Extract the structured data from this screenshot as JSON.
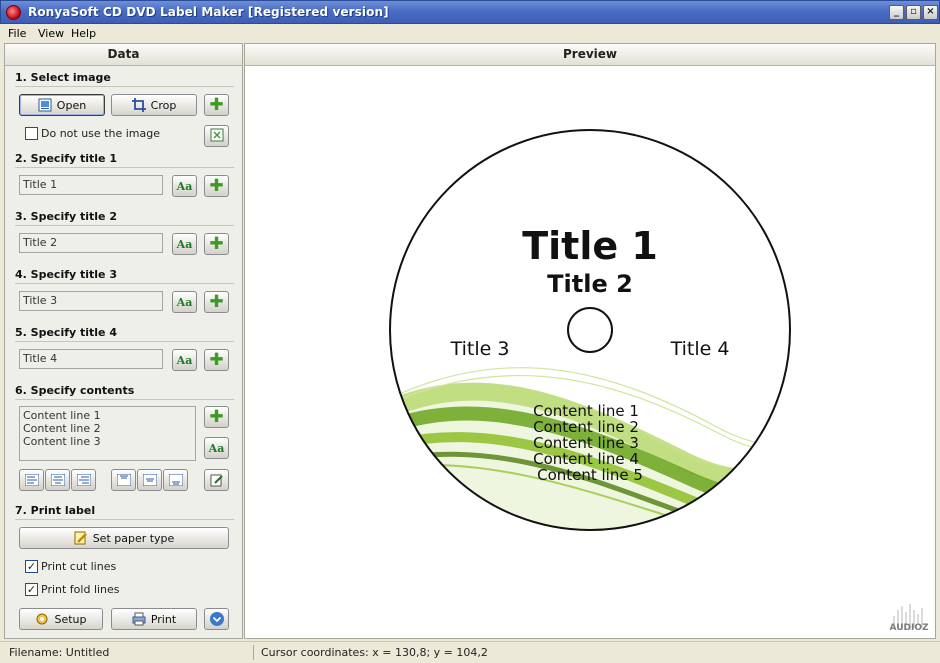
{
  "window": {
    "title": "RonyaSoft CD DVD Label Maker [Registered version]"
  },
  "menu": [
    "File",
    "View",
    "Help"
  ],
  "panels": {
    "data": "Data",
    "preview": "Preview"
  },
  "sections": {
    "select_image": "1. Select image",
    "title1": "2. Specify title 1",
    "title2": "3. Specify title 2",
    "title3": "4. Specify title 3",
    "title4": "5. Specify title 4",
    "contents": "6. Specify contents",
    "print": "7. Print label"
  },
  "buttons": {
    "open": "Open",
    "crop": "Crop",
    "set_paper": "Set paper type",
    "setup": "Setup",
    "print": "Print",
    "font_glyph": "Aa"
  },
  "checkboxes": {
    "no_image": {
      "label": "Do not use the image",
      "checked": false
    },
    "cut_lines": {
      "label": "Print cut lines",
      "checked": true
    },
    "fold_lines": {
      "label": "Print fold lines",
      "checked": true
    }
  },
  "fields": {
    "title1": "Title 1",
    "title2": "Title 2",
    "title3": "Title 3",
    "title4": "Title 4"
  },
  "contents_lines": [
    "Content line 1",
    "Content line 2",
    "Content line 3"
  ],
  "disc": {
    "title1": "Title 1",
    "title2": "Title 2",
    "title3": "Title 3",
    "title4": "Title 4",
    "content_lines": [
      "Content line 1",
      "Content line 2",
      "Content line 3",
      "Content line 4",
      "Content line 5"
    ]
  },
  "status": {
    "filename": "Filename: Untitled",
    "cursor": "Cursor coordinates: x = 130,8; y = 104,2"
  },
  "watermark": "AUDIOZ",
  "colors": {
    "titlebar": "#4A6CC3",
    "wave_green": "#8DBE2A",
    "wave_dark": "#5E8F10"
  }
}
